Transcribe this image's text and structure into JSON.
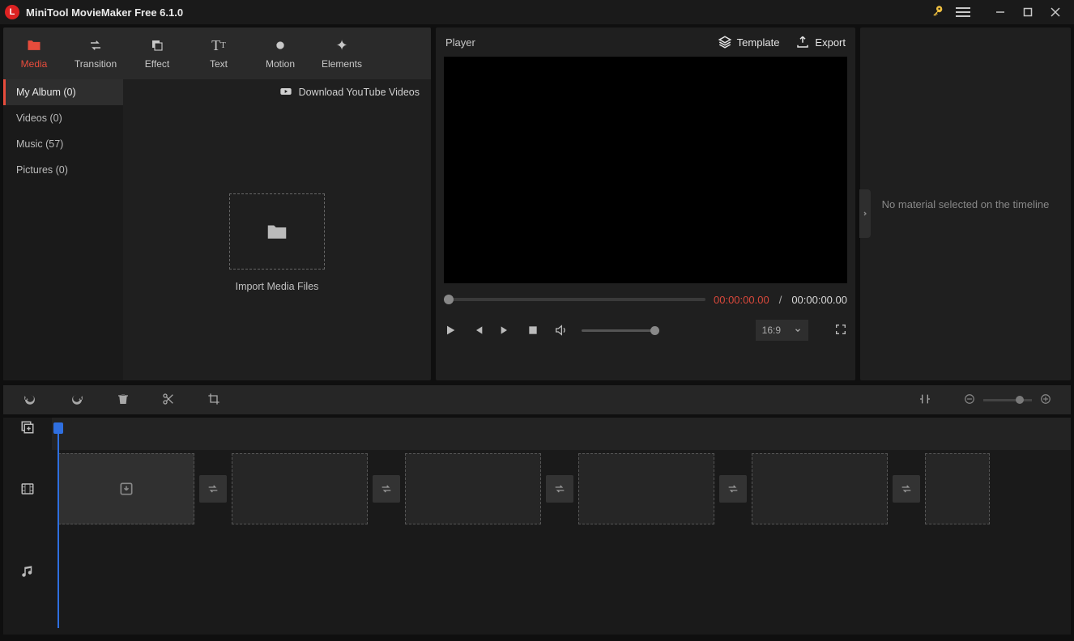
{
  "titlebar": {
    "app_name": "MiniTool MovieMaker Free 6.1.0"
  },
  "tabs": {
    "media": "Media",
    "transition": "Transition",
    "effect": "Effect",
    "text": "Text",
    "motion": "Motion",
    "elements": "Elements"
  },
  "media_sidebar": {
    "items": [
      {
        "label": "My Album (0)"
      },
      {
        "label": "Videos (0)"
      },
      {
        "label": "Music (57)"
      },
      {
        "label": "Pictures (0)"
      }
    ],
    "download_yt": "Download YouTube Videos",
    "import_label": "Import Media Files"
  },
  "player": {
    "title": "Player",
    "template_label": "Template",
    "export_label": "Export",
    "time_current": "00:00:00.00",
    "time_sep": "/",
    "time_total": "00:00:00.00",
    "aspect": "16:9"
  },
  "inspector": {
    "empty_text": "No material selected on the timeline"
  }
}
